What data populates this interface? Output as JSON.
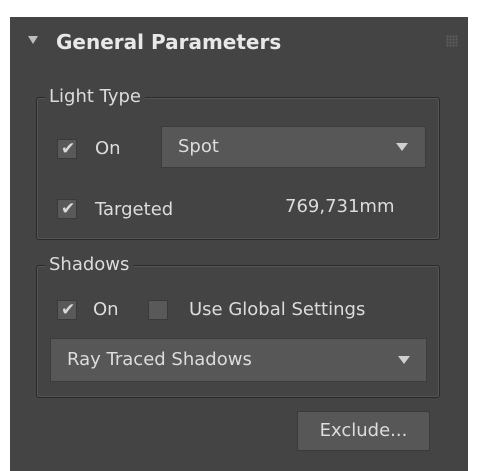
{
  "rollout": {
    "title": "General Parameters",
    "header_icons": [
      "collapse-arrow-icon",
      "grip-icon"
    ]
  },
  "light_type": {
    "group_label": "Light Type",
    "on_checked": true,
    "on_label": "On",
    "type_selected": "Spot",
    "targeted_checked": true,
    "targeted_label": "Targeted",
    "target_distance": "769,731mm"
  },
  "shadows": {
    "group_label": "Shadows",
    "on_checked": true,
    "on_label": "On",
    "use_global_checked": false,
    "use_global_label": "Use Global Settings",
    "type_selected": "Ray Traced Shadows"
  },
  "exclude_button": {
    "label": "Exclude..."
  },
  "glyphs": {
    "check": "✔"
  },
  "colors": {
    "panel_bg": "#444444",
    "text": "#dcdcdc",
    "control_bg": "#575757"
  }
}
